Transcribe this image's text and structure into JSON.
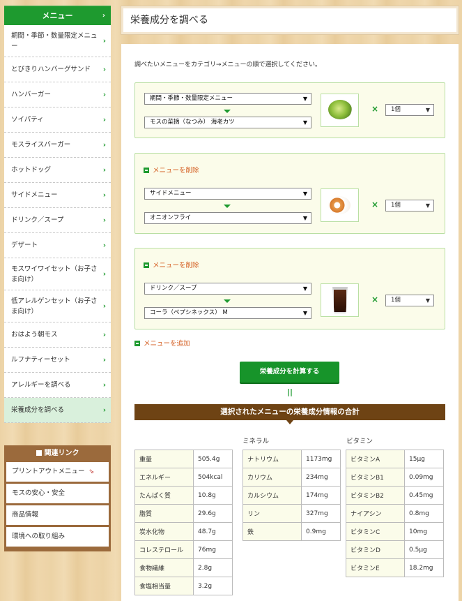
{
  "sidebar": {
    "header": "メニュー",
    "items": [
      {
        "label": "期間・季節・数量限定メニュー"
      },
      {
        "label": "とびきりハンバーグサンド"
      },
      {
        "label": "ハンバーガー"
      },
      {
        "label": "ソイパティ"
      },
      {
        "label": "モスライスバーガー"
      },
      {
        "label": "ホットドッグ"
      },
      {
        "label": "サイドメニュー"
      },
      {
        "label": "ドリンク／スープ"
      },
      {
        "label": "デザート"
      },
      {
        "label": "モスワイワイセット（お子さま向け）"
      },
      {
        "label": "低アレルゲンセット（お子さま向け）"
      },
      {
        "label": "おはよう朝モス"
      },
      {
        "label": "ルフナティーセット"
      },
      {
        "label": "アレルギーを調べる"
      },
      {
        "label": "栄養成分を調べる"
      }
    ],
    "arrow": "›"
  },
  "related": {
    "header": "関連リンク",
    "items": [
      {
        "label": "プリントアウトメニュー"
      },
      {
        "label": "モスの安心・安全"
      },
      {
        "label": "商品情報"
      },
      {
        "label": "環境への取り組み"
      }
    ]
  },
  "page": {
    "title": "栄養成分を調べる",
    "intro": "調べたいメニューをカテゴリ→メニューの順で選択してください。",
    "delete_label": "メニューを削除",
    "add_label": "メニューを追加",
    "calc_label": "栄養成分を計算する",
    "equals": "||",
    "times": "×",
    "result_title": "選択されたメニューの栄養成分情報の合計"
  },
  "selections": [
    {
      "category": "期間・季節・数量限定メニュー",
      "menu": "モスの菜摘（なつみ） 海老カツ",
      "qty": "1個",
      "thumb": "salad-icon"
    },
    {
      "category": "サイドメニュー",
      "menu": "オニオンフライ",
      "qty": "1個",
      "thumb": "onion-rings-icon"
    },
    {
      "category": "ドリンク／スープ",
      "menu": "コーラ（ペプシネックス） M",
      "qty": "1個",
      "thumb": "cola-icon"
    }
  ],
  "nutrition": {
    "basic": [
      {
        "k": "重量",
        "v": "505.4g"
      },
      {
        "k": "エネルギー",
        "v": "504kcal"
      },
      {
        "k": "たんぱく質",
        "v": "10.8g"
      },
      {
        "k": "脂質",
        "v": "29.6g"
      },
      {
        "k": "炭水化物",
        "v": "48.7g"
      },
      {
        "k": "コレステロール",
        "v": "76mg"
      },
      {
        "k": "食物繊維",
        "v": "2.8g"
      },
      {
        "k": "食塩相当量",
        "v": "3.2g"
      }
    ],
    "mineral_label": "ミネラル",
    "minerals": [
      {
        "k": "ナトリウム",
        "v": "1173mg"
      },
      {
        "k": "カリウム",
        "v": "234mg"
      },
      {
        "k": "カルシウム",
        "v": "174mg"
      },
      {
        "k": "リン",
        "v": "327mg"
      },
      {
        "k": "鉄",
        "v": "0.9mg"
      }
    ],
    "vitamin_label": "ビタミン",
    "vitamins": [
      {
        "k": "ビタミンA",
        "v": "15μg"
      },
      {
        "k": "ビタミンB1",
        "v": "0.09mg"
      },
      {
        "k": "ビタミンB2",
        "v": "0.45mg"
      },
      {
        "k": "ナイアシン",
        "v": "0.8mg"
      },
      {
        "k": "ビタミンC",
        "v": "10mg"
      },
      {
        "k": "ビタミンD",
        "v": "0.5μg"
      },
      {
        "k": "ビタミンE",
        "v": "18.2mg"
      }
    ]
  },
  "colors": {
    "accent": "#1e9a2f",
    "brown": "#6e4314",
    "link": "#d35a1c"
  }
}
